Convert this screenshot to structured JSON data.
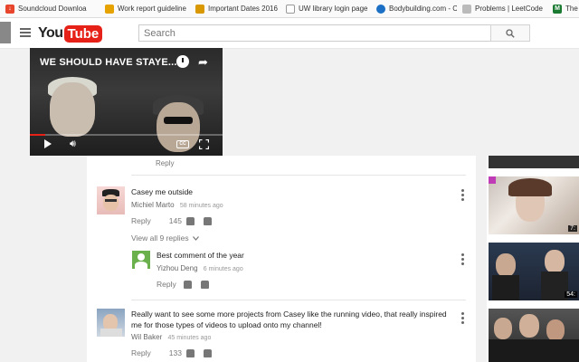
{
  "bookmarks": [
    {
      "label": "Soundcloud Downloa",
      "color": "#e8462c"
    },
    {
      "label": "Work report guideline",
      "color": "#e6a300"
    },
    {
      "label": "Important Dates 2016",
      "color": "#d99800"
    },
    {
      "label": "UW library login page",
      "color": "#7a7a7a"
    },
    {
      "label": "Bodybuilding.com - C",
      "color": "#1b6fc4"
    },
    {
      "label": "Problems | LeetCode",
      "color": "#a0a0a0"
    },
    {
      "label": "The S",
      "color": "#1a7a32"
    }
  ],
  "header": {
    "logo_you": "You",
    "logo_tube": "Tube",
    "search_placeholder": "Search"
  },
  "player": {
    "title": "WE SHOULD HAVE STAYE...",
    "progress": 0.08
  },
  "reply_top": "Reply",
  "comments": [
    {
      "text": "Casey me outside",
      "author": "Michiel Marto",
      "time": "58 minutes ago",
      "reply": "Reply",
      "likes": "145",
      "view_replies": "View all 9 replies"
    },
    {
      "text": "Best comment of the year",
      "author": "Yizhou Deng",
      "time": "6 minutes ago",
      "reply": "Reply"
    },
    {
      "text": "Really want to see some more projects from Casey like the running video, that really inspired me for those types of videos to upload onto my channel!",
      "author": "Wil Baker",
      "time": "45 minutes ago",
      "reply": "Reply",
      "likes": "133"
    }
  ],
  "sidebar": {
    "durations": [
      "7:",
      "54:",
      ""
    ]
  },
  "colors": {
    "brand": "#e62117"
  }
}
